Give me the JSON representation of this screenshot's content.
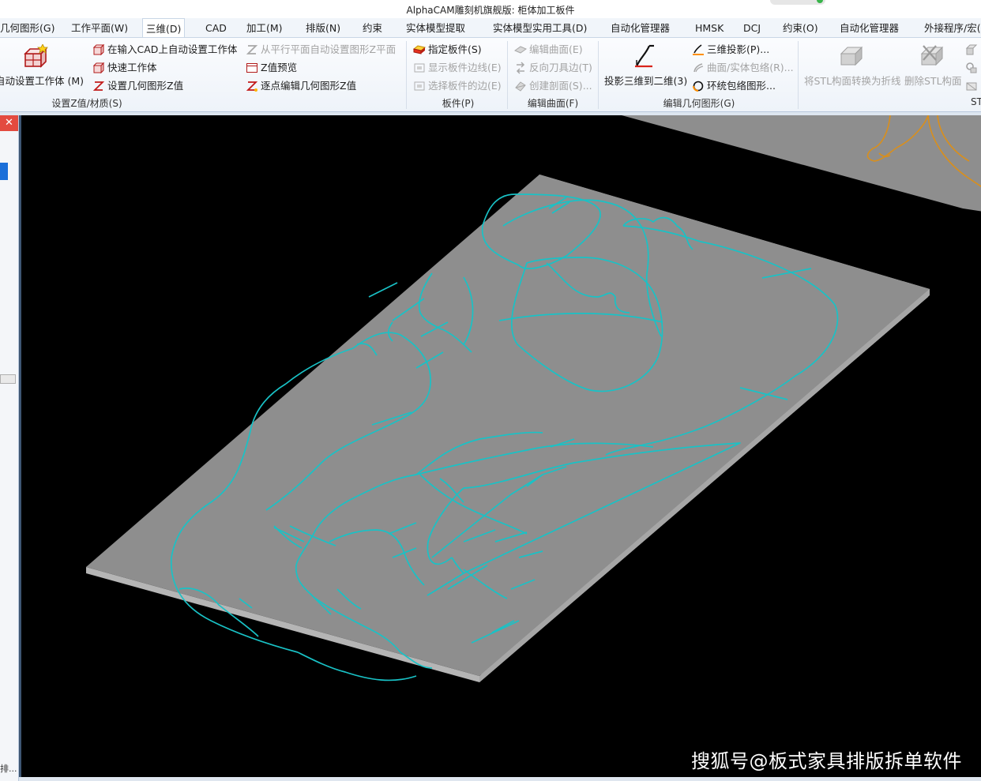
{
  "app": {
    "title": "AlphaCAM雕刻机旗舰版: 柜体加工板件"
  },
  "menu": {
    "tabs": [
      {
        "label": "几何图形(G)"
      },
      {
        "label": "工作平面(W)"
      },
      {
        "label": "三维(D)"
      },
      {
        "label": "CAD"
      },
      {
        "label": "加工(M)"
      },
      {
        "label": "排版(N)"
      },
      {
        "label": "约束"
      },
      {
        "label": "实体模型提取"
      },
      {
        "label": "实体模型实用工具(D)"
      },
      {
        "label": "自动化管理器"
      },
      {
        "label": "HMSK"
      },
      {
        "label": "DCJ"
      },
      {
        "label": "约束(O)"
      },
      {
        "label": "自动化管理器"
      },
      {
        "label": "外接程序/宏(A)"
      }
    ],
    "active_index": 2
  },
  "ribbon": {
    "group_z": {
      "big": "自动设置工作体 (M)",
      "items": [
        "在输入CAD上自动设置工作体",
        "快速工作体",
        "设置几何图形Z值"
      ],
      "items2": [
        "从平行平面自动设置图形Z平面",
        "Z值预览",
        "逐点编辑几何图形Z值"
      ],
      "label": "设置Z值/材质(S)"
    },
    "group_board": {
      "items": [
        "指定板件(S)",
        "显示板件边线(E)",
        "选择板件的边(E)"
      ],
      "label": "板件(P)"
    },
    "group_surface": {
      "items": [
        "编辑曲面(E)",
        "反向刀具边(T)",
        "创建剖面(S)..."
      ],
      "label": "编辑曲面(F)"
    },
    "group_geo": {
      "big": "投影三维到二维(3)",
      "items": [
        "三维投影(P)...",
        "曲面/实体包络(R)...",
        "环统包络图形..."
      ],
      "label": "编辑几何图形(G)"
    },
    "group_stl": {
      "big1": "将STL构面转换为折线",
      "big2": "删除STL构面",
      "label": "ST"
    }
  },
  "left_panel": {
    "close": "✕",
    "bottom_label": "排..."
  },
  "viewport": {
    "background": "#000000",
    "board_color": "#8e8e8e",
    "path_color": "#19c2c6",
    "other_path_color": "#d98f1c"
  },
  "watermark": "搜狐号@板式家具排版拆单软件",
  "icons": [
    "workpiece-icon",
    "cad-workpiece-icon",
    "quick-workpiece-icon",
    "set-z-icon",
    "parallel-plane-icon",
    "z-preview-icon",
    "point-edit-icon",
    "board-icon",
    "board-edge-icon",
    "select-edge-icon",
    "edit-surface-icon",
    "reverse-tool-icon",
    "section-icon",
    "project-3d-2d-icon",
    "projection-icon",
    "envelope-icon",
    "loop-envelope-icon",
    "stl-convert-icon",
    "stl-delete-icon"
  ]
}
